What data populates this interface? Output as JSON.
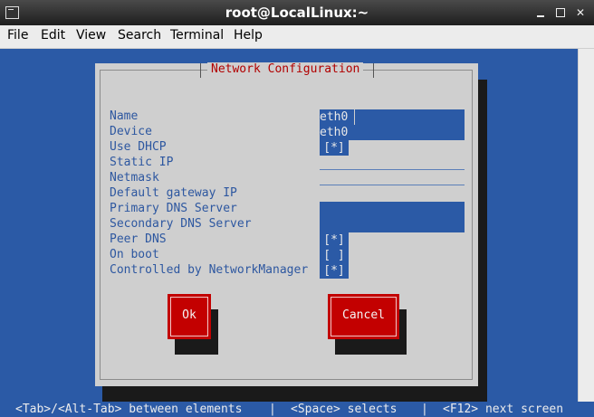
{
  "window": {
    "title": "root@LocalLinux:~"
  },
  "menu": [
    "File",
    "Edit",
    "View",
    "Search",
    "Terminal",
    "Help"
  ],
  "dialog": {
    "title": "Network Configuration",
    "fields": [
      {
        "label": "Name",
        "value": "eth0"
      },
      {
        "label": "Device",
        "value": "eth0"
      },
      {
        "label": "Use DHCP",
        "value": "[*]"
      },
      {
        "label": "Static IP",
        "value": ""
      },
      {
        "label": "Netmask",
        "value": ""
      },
      {
        "label": "Default gateway IP",
        "value": ""
      },
      {
        "label": "Primary DNS Server",
        "value": ""
      },
      {
        "label": "Secondary DNS Server",
        "value": ""
      },
      {
        "label": "Peer DNS",
        "value": "[*]"
      },
      {
        "label": "On boot",
        "value": "[ ]"
      },
      {
        "label": "Controlled by NetworkManager",
        "value": "[*]"
      }
    ],
    "ok_label": "Ok",
    "cancel_label": "Cancel"
  },
  "footer": {
    "hint_tab": "<Tab>/<Alt-Tab> between elements",
    "sep1": "|",
    "hint_space": "<Space> selects",
    "sep2": "|",
    "hint_f12": "<F12> next screen"
  },
  "colors": {
    "background": "#2b5aa6",
    "dialog": "#cfcfcf",
    "title_text": "#b10000",
    "button": "#c30000"
  }
}
